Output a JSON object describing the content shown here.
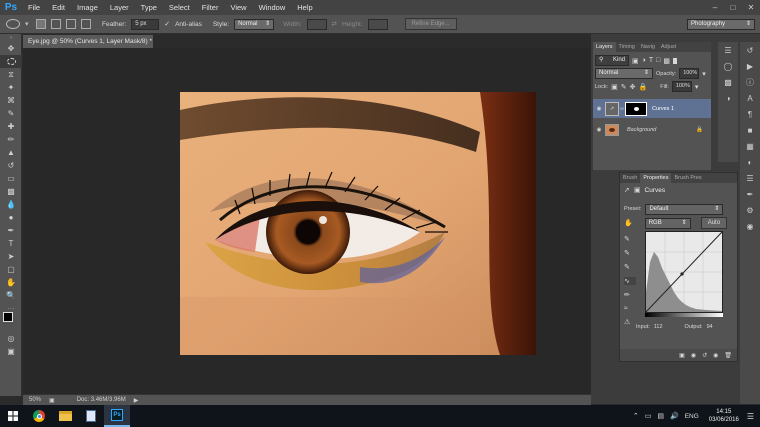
{
  "menubar": {
    "app_logo": "Ps",
    "items": [
      "File",
      "Edit",
      "Image",
      "Layer",
      "Type",
      "Select",
      "Filter",
      "View",
      "Window",
      "Help"
    ]
  },
  "options": {
    "feather_label": "Feather:",
    "feather_value": "5 px",
    "antialias_label": "Anti-alias",
    "style_label": "Style:",
    "style_value": "Normal",
    "width_label": "Width:",
    "height_label": "Height:",
    "refine_edge_label": "Refine Edge...",
    "workspace_value": "Photography"
  },
  "document": {
    "tab_title": "Eye.jpg @ 50% (Curves 1, Layer Mask/8) *",
    "zoom": "50%",
    "doc_size": "Doc: 3.46M/3.96M"
  },
  "layers_panel": {
    "tabs": [
      "Layers",
      "Timing",
      "Navig",
      "Adjust"
    ],
    "filter_label": "Kind",
    "blend_mode": "Normal",
    "opacity_label": "Opacity:",
    "opacity_value": "100%",
    "lock_label": "Lock:",
    "fill_label": "Fill:",
    "fill_value": "100%",
    "layers": [
      {
        "name": "Curves 1"
      },
      {
        "name": "Background"
      }
    ]
  },
  "properties_panel": {
    "tabs": [
      "Brush",
      "Properties",
      "Brush Pres"
    ],
    "title": "Curves",
    "preset_label": "Preset:",
    "preset_value": "Default",
    "channel_value": "RGB",
    "auto_label": "Auto",
    "input_label": "Input:",
    "input_value": "112",
    "output_label": "Output:",
    "output_value": "94"
  },
  "taskbar": {
    "language": "ENG",
    "time": "14:15",
    "date": "03/06/2016"
  },
  "colors": {
    "accent": "#31a8ff",
    "panel": "#535353",
    "canvas_bg": "#282828"
  }
}
